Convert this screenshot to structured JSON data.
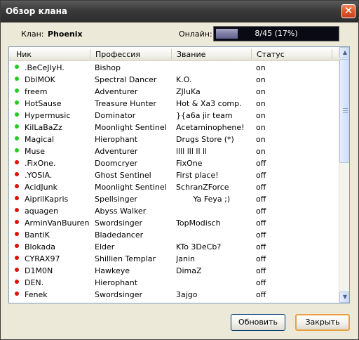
{
  "window": {
    "title": "Обзор клана",
    "close_symbol": "✕"
  },
  "clan": {
    "label": "Клан:",
    "name": "Phoenix"
  },
  "online": {
    "label": "Онлайн:",
    "text": "8/45 (17%)",
    "fraction": 0.1778
  },
  "columns": {
    "name": "Ник",
    "profession": "Профессия",
    "title": "Звание",
    "status": "Статус"
  },
  "colors": {
    "online_dot": "#22cc22",
    "offline_dot": "#dd1111"
  },
  "members": [
    {
      "name": ".BeCeJIyH.",
      "profession": "Bishop",
      "title": "",
      "status": "on"
    },
    {
      "name": "DblMOK",
      "profession": "Spectral Dancer",
      "title": "K.O.",
      "status": "on"
    },
    {
      "name": "freem",
      "profession": "Adventurer",
      "title": "ZJIuKa",
      "status": "on"
    },
    {
      "name": "HotSause",
      "profession": "Treasure Hunter",
      "title": "Hot & Xa3 comp.",
      "status": "on"
    },
    {
      "name": "Hypermusic",
      "profession": "Dominator",
      "title": "}{a6a jir team",
      "status": "on"
    },
    {
      "name": "KilLaBaZz",
      "profession": "Moonlight Sentinel",
      "title": "Acetaminophene!",
      "status": "on"
    },
    {
      "name": "Magical",
      "profession": "Hierophant",
      "title": "Drugs Store (*)",
      "status": "on"
    },
    {
      "name": "Muse",
      "profession": "Adventurer",
      "title": "llll lll ll ll",
      "status": "on"
    },
    {
      "name": ".FixOne.",
      "profession": "Doomcryer",
      "title": "FixOne",
      "status": "off"
    },
    {
      "name": ".YOSIA.",
      "profession": "Ghost Sentinel",
      "title": "First place!",
      "status": "off"
    },
    {
      "name": "AcidJunk",
      "profession": "Moonlight Sentinel",
      "title": "SchranZForce",
      "status": "off"
    },
    {
      "name": "AiprilKapris",
      "profession": "Spellsinger",
      "title": "       Ya Feya ;)",
      "status": "off"
    },
    {
      "name": "aquagen",
      "profession": "Abyss Walker",
      "title": "",
      "status": "off"
    },
    {
      "name": "ArminVanBuuren",
      "profession": "Swordsinger",
      "title": "TopModisch",
      "status": "off"
    },
    {
      "name": "BantiK",
      "profession": "Bladedancer",
      "title": "",
      "status": "off"
    },
    {
      "name": "Blokada",
      "profession": "Elder",
      "title": "KTo 3DeCb?",
      "status": "off"
    },
    {
      "name": "CYRAX97",
      "profession": "Shillien Templar",
      "title": "Janin",
      "status": "off"
    },
    {
      "name": "D1M0N",
      "profession": "Hawkeye",
      "title": "DimaZ",
      "status": "off"
    },
    {
      "name": "DEN.",
      "profession": "Hierophant",
      "title": "",
      "status": "off"
    },
    {
      "name": "Fenek",
      "profession": "Swordsinger",
      "title": "3ajgo",
      "status": "off"
    }
  ],
  "buttons": {
    "refresh": "Обновить",
    "close": "Закрыть"
  },
  "scrollbar": {
    "up_symbol": "▲",
    "down_symbol": "▼"
  }
}
